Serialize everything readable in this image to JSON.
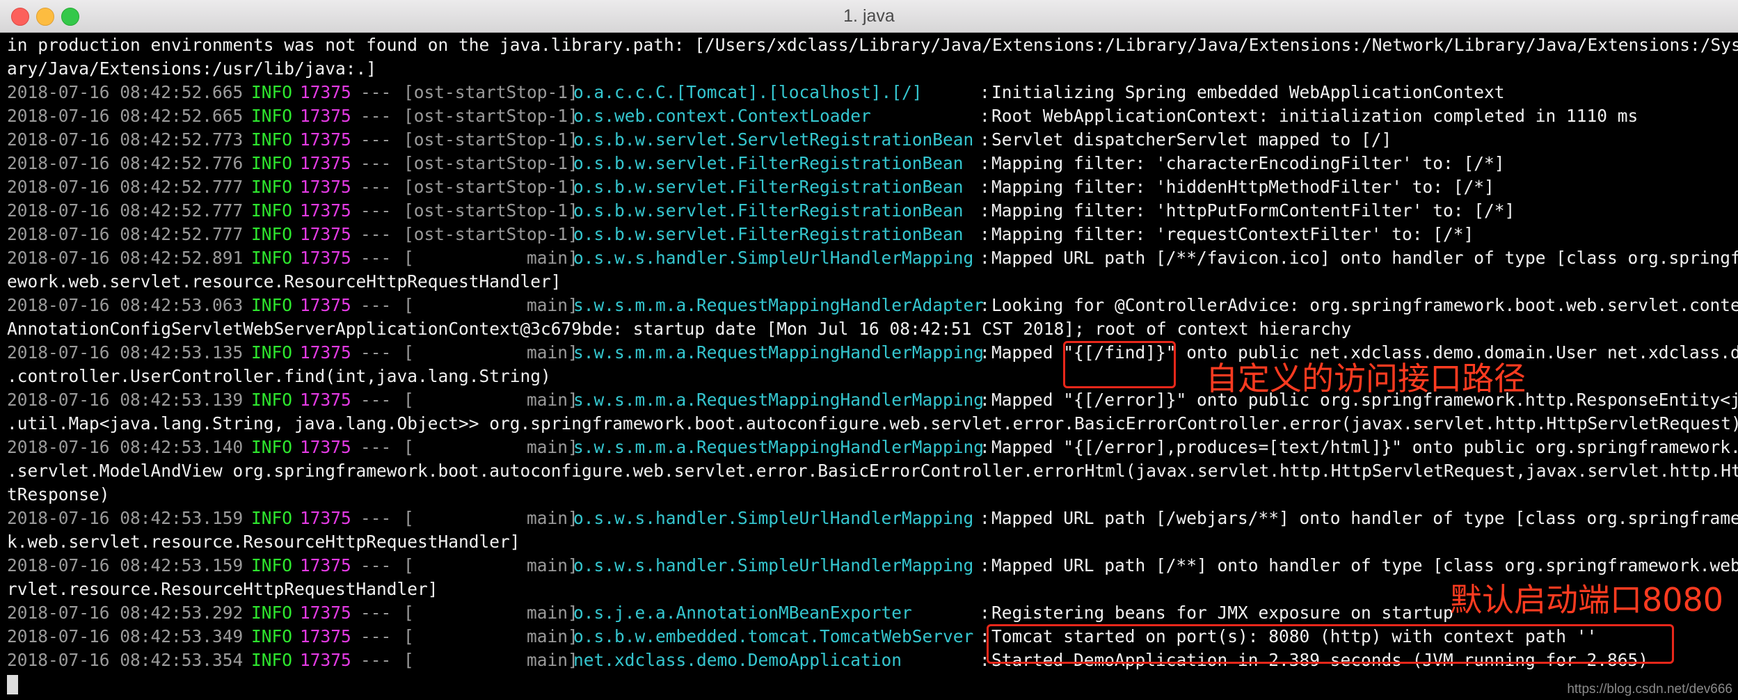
{
  "window": {
    "title": "1. java"
  },
  "log": {
    "preamble": [
      "in production environments was not found on the java.library.path: [/Users/xdclass/Library/Java/Extensions:/Library/Java/Extensions:/Network/Library/Java/Extensions:/System/Libr",
      "ary/Java/Extensions:/usr/lib/java:.]"
    ],
    "entries": [
      {
        "ts": "2018-07-16 08:42:52.665",
        "level": "INFO",
        "pid": "17375",
        "sep": "---",
        "thread": "[ost-startStop-1]",
        "logger": "o.a.c.c.C.[Tomcat].[localhost].[/]",
        "colon": ":",
        "message": "Initializing Spring embedded WebApplicationContext",
        "cont": []
      },
      {
        "ts": "2018-07-16 08:42:52.665",
        "level": "INFO",
        "pid": "17375",
        "sep": "---",
        "thread": "[ost-startStop-1]",
        "logger": "o.s.web.context.ContextLoader",
        "colon": ":",
        "message": "Root WebApplicationContext: initialization completed in 1110 ms",
        "cont": []
      },
      {
        "ts": "2018-07-16 08:42:52.773",
        "level": "INFO",
        "pid": "17375",
        "sep": "---",
        "thread": "[ost-startStop-1]",
        "logger": "o.s.b.w.servlet.ServletRegistrationBean",
        "colon": ":",
        "message": "Servlet dispatcherServlet mapped to [/]",
        "cont": []
      },
      {
        "ts": "2018-07-16 08:42:52.776",
        "level": "INFO",
        "pid": "17375",
        "sep": "---",
        "thread": "[ost-startStop-1]",
        "logger": "o.s.b.w.servlet.FilterRegistrationBean",
        "colon": ":",
        "message": "Mapping filter: 'characterEncodingFilter' to: [/*]",
        "cont": []
      },
      {
        "ts": "2018-07-16 08:42:52.777",
        "level": "INFO",
        "pid": "17375",
        "sep": "---",
        "thread": "[ost-startStop-1]",
        "logger": "o.s.b.w.servlet.FilterRegistrationBean",
        "colon": ":",
        "message": "Mapping filter: 'hiddenHttpMethodFilter' to: [/*]",
        "cont": []
      },
      {
        "ts": "2018-07-16 08:42:52.777",
        "level": "INFO",
        "pid": "17375",
        "sep": "---",
        "thread": "[ost-startStop-1]",
        "logger": "o.s.b.w.servlet.FilterRegistrationBean",
        "colon": ":",
        "message": "Mapping filter: 'httpPutFormContentFilter' to: [/*]",
        "cont": []
      },
      {
        "ts": "2018-07-16 08:42:52.777",
        "level": "INFO",
        "pid": "17375",
        "sep": "---",
        "thread": "[ost-startStop-1]",
        "logger": "o.s.b.w.servlet.FilterRegistrationBean",
        "colon": ":",
        "message": "Mapping filter: 'requestContextFilter' to: [/*]",
        "cont": []
      },
      {
        "ts": "2018-07-16 08:42:52.891",
        "level": "INFO",
        "pid": "17375",
        "sep": "---",
        "thread": "[           main]",
        "logger": "o.s.w.s.handler.SimpleUrlHandlerMapping",
        "colon": ":",
        "message": "Mapped URL path [/**/favicon.ico] onto handler of type [class org.springfram",
        "cont": [
          "ework.web.servlet.resource.ResourceHttpRequestHandler]"
        ]
      },
      {
        "ts": "2018-07-16 08:42:53.063",
        "level": "INFO",
        "pid": "17375",
        "sep": "---",
        "thread": "[           main]",
        "logger": "s.w.s.m.m.a.RequestMappingHandlerAdapter",
        "colon": ":",
        "message": "Looking for @ControllerAdvice: org.springframework.boot.web.servlet.context.",
        "cont": [
          "AnnotationConfigServletWebServerApplicationContext@3c679bde: startup date [Mon Jul 16 08:42:51 CST 2018]; root of context hierarchy"
        ]
      },
      {
        "ts": "2018-07-16 08:42:53.135",
        "level": "INFO",
        "pid": "17375",
        "sep": "---",
        "thread": "[           main]",
        "logger": "s.w.s.m.m.a.RequestMappingHandlerMapping",
        "colon": ":",
        "message": "Mapped \"{[/find]}\" onto public net.xdclass.demo.domain.User net.xdclass.demo",
        "cont": [
          ".controller.UserController.find(int,java.lang.String)"
        ]
      },
      {
        "ts": "2018-07-16 08:42:53.139",
        "level": "INFO",
        "pid": "17375",
        "sep": "---",
        "thread": "[           main]",
        "logger": "s.w.s.m.m.a.RequestMappingHandlerMapping",
        "colon": ":",
        "message": "Mapped \"{[/error]}\" onto public org.springframework.http.ResponseEntity<java",
        "cont": [
          ".util.Map<java.lang.String, java.lang.Object>> org.springframework.boot.autoconfigure.web.servlet.error.BasicErrorController.error(javax.servlet.http.HttpServletRequest)"
        ]
      },
      {
        "ts": "2018-07-16 08:42:53.140",
        "level": "INFO",
        "pid": "17375",
        "sep": "---",
        "thread": "[           main]",
        "logger": "s.w.s.m.m.a.RequestMappingHandlerMapping",
        "colon": ":",
        "message": "Mapped \"{[/error],produces=[text/html]}\" onto public org.springframework.web",
        "cont": [
          ".servlet.ModelAndView org.springframework.boot.autoconfigure.web.servlet.error.BasicErrorController.errorHtml(javax.servlet.http.HttpServletRequest,javax.servlet.http.HttpServle",
          "tResponse)"
        ]
      },
      {
        "ts": "2018-07-16 08:42:53.159",
        "level": "INFO",
        "pid": "17375",
        "sep": "---",
        "thread": "[           main]",
        "logger": "o.s.w.s.handler.SimpleUrlHandlerMapping",
        "colon": ":",
        "message": "Mapped URL path [/webjars/**] onto handler of type [class org.springframewor",
        "cont": [
          "k.web.servlet.resource.ResourceHttpRequestHandler]"
        ]
      },
      {
        "ts": "2018-07-16 08:42:53.159",
        "level": "INFO",
        "pid": "17375",
        "sep": "---",
        "thread": "[           main]",
        "logger": "o.s.w.s.handler.SimpleUrlHandlerMapping",
        "colon": ":",
        "message": "Mapped URL path [/**] onto handler of type [class org.springframework.web.se",
        "cont": [
          "rvlet.resource.ResourceHttpRequestHandler]"
        ]
      },
      {
        "ts": "2018-07-16 08:42:53.292",
        "level": "INFO",
        "pid": "17375",
        "sep": "---",
        "thread": "[           main]",
        "logger": "o.s.j.e.a.AnnotationMBeanExporter",
        "colon": ":",
        "message": "Registering beans for JMX exposure on startup",
        "cont": []
      },
      {
        "ts": "2018-07-16 08:42:53.349",
        "level": "INFO",
        "pid": "17375",
        "sep": "---",
        "thread": "[           main]",
        "logger": "o.s.b.w.embedded.tomcat.TomcatWebServer",
        "colon": ":",
        "message": "Tomcat started on port(s): 8080 (http) with context path ''",
        "cont": []
      },
      {
        "ts": "2018-07-16 08:42:53.354",
        "level": "INFO",
        "pid": "17375",
        "sep": "---",
        "thread": "[           main]",
        "logger": "net.xdclass.demo.DemoApplication",
        "colon": ":",
        "message": "Started DemoApplication in 2.389 seconds (JVM running for 2.865)",
        "cont": []
      }
    ]
  },
  "annotations": {
    "find_label": "自定义的访问接口路径",
    "port_label": "默认启动端口8080"
  },
  "watermark": "https://blog.csdn.net/dev666",
  "colors": {
    "timestamp": "#9a9a9a",
    "level": "#2ee62e",
    "pid": "#e23ae2",
    "logger": "#35c6cf",
    "annotation": "#e8271a"
  }
}
